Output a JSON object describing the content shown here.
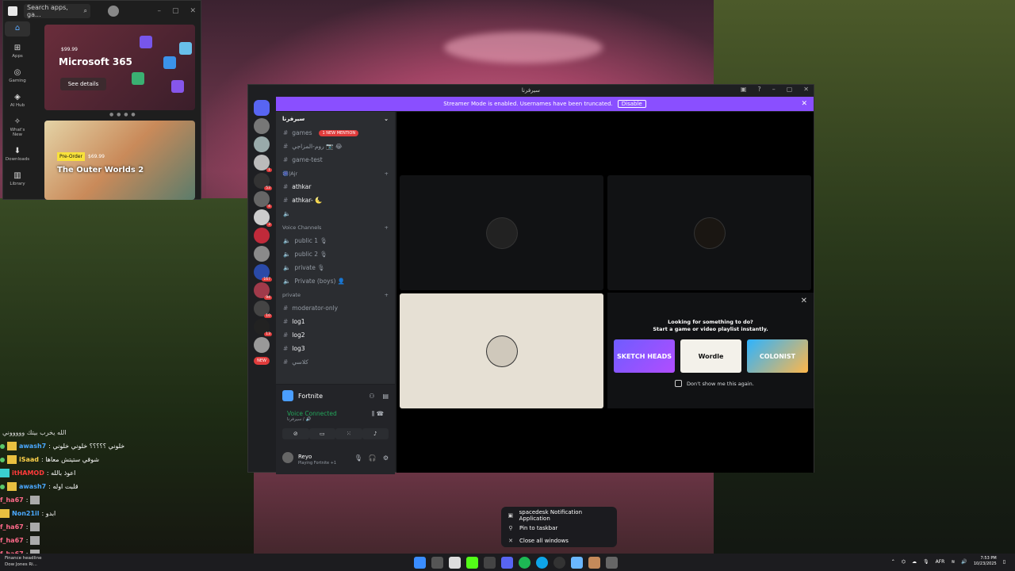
{
  "colors": {
    "discord_banner": "#8a4fff",
    "voice_green": "#23a55a",
    "mention_red": "#e03c3c",
    "xbox_accent": "#5aa9ff"
  },
  "xbox": {
    "search_placeholder": "Search apps, ga...",
    "rail": [
      {
        "label": "",
        "icon": "home-icon"
      },
      {
        "label": "Apps",
        "icon": "apps-icon"
      },
      {
        "label": "Gaming",
        "icon": "controller-icon"
      },
      {
        "label": "AI Hub",
        "icon": "ai-hub-icon"
      },
      {
        "label": "What's New",
        "icon": "whats-new-icon"
      },
      {
        "label": "Downloads",
        "icon": "downloads-icon"
      },
      {
        "label": "Library",
        "icon": "library-icon"
      }
    ],
    "featured1": {
      "price": "$99.99",
      "name": "Microsoft 365",
      "button": "See details"
    },
    "featured2": {
      "badge": "Pre-Order",
      "price": "$69.99",
      "name": "The Outer Worlds 2"
    }
  },
  "discord": {
    "window_title": "سيرفرنا",
    "banner_text": "Streamer Mode is enabled. Usernames have been truncated.",
    "banner_button": "Disable",
    "guild_name": "سيرفرنا",
    "mention_pill": "1 NEW MENTION",
    "server_new_pill": "NEW",
    "channels": [
      {
        "type": "text",
        "name": "games",
        "bold": false
      },
      {
        "type": "text",
        "name": "روم-المزاجي 📷 😂",
        "bold": false
      },
      {
        "type": "text",
        "name": "game-test",
        "bold": false
      },
      {
        "type": "category",
        "name": "🎆|Ajr"
      },
      {
        "type": "text",
        "name": "athkar",
        "bold": true
      },
      {
        "type": "text",
        "name": "athkar- 🌜",
        "bold": true
      },
      {
        "type": "voice",
        "name": "",
        "bold": false
      },
      {
        "type": "category",
        "name": "Voice Channels"
      },
      {
        "type": "voice",
        "name": "public 1 🎙",
        "bold": false
      },
      {
        "type": "voice",
        "name": "public 2 🎙",
        "bold": false
      },
      {
        "type": "voice",
        "name": "private 🎙",
        "bold": false
      },
      {
        "type": "voice",
        "name": "Private (boys) 👤",
        "bold": false
      },
      {
        "type": "category",
        "name": "private"
      },
      {
        "type": "text",
        "name": "moderator-only",
        "bold": false
      },
      {
        "type": "text",
        "name": "log1",
        "bold": true
      },
      {
        "type": "text",
        "name": "log2",
        "bold": true
      },
      {
        "type": "text",
        "name": "log3",
        "bold": true
      },
      {
        "type": "text",
        "name": "كلاسي",
        "bold": false
      }
    ],
    "activity": {
      "name": "Fortnite"
    },
    "voice": {
      "status": "Voice Connected",
      "channel": "سيرفرنا / 🔊"
    },
    "user": {
      "name": "Reyo",
      "status": "Playing Fortnite +1"
    },
    "suggest": {
      "line1": "Looking for something to do?",
      "line2": "Start a game or video playlist instantly.",
      "games": [
        "SKETCH HEADS",
        "Wordle",
        "COLONIST"
      ],
      "checkbox": "Don't show me this again."
    }
  },
  "chat": [
    {
      "name": "",
      "msg": "الله يخرب بيتك وووووني",
      "color": "#ff5a5a"
    },
    {
      "name": "awash7",
      "msg": ": خلوني ؟؟؟؟؟ خلوني خلوني",
      "color": "#4aa8ff"
    },
    {
      "name": "iSaad",
      "msg": ": شوقي ستيتش معاها",
      "color": "#ffd24a"
    },
    {
      "name": "itHAMOD",
      "msg": ": اعوذ بالله",
      "color": "#ff3a3a"
    },
    {
      "name": "awash7",
      "msg": ": قلبت اوله",
      "color": "#4aa8ff"
    },
    {
      "name": "f_ha67",
      "msg": ":",
      "color": "#ff6a8a"
    },
    {
      "name": "Non21il",
      "msg": ": ابدو",
      "color": "#4aa8ff"
    },
    {
      "name": "f_ha67",
      "msg": ":",
      "color": "#ff6a8a"
    },
    {
      "name": "f_ha67",
      "msg": ":",
      "color": "#ff6a8a"
    },
    {
      "name": "f_ha67",
      "msg": ":",
      "color": "#ff6a8a"
    }
  ],
  "weather": {
    "line1": "Finance headline",
    "line2": "Dow Jones Ri..."
  },
  "context_menu": {
    "items": [
      {
        "label": "spacedesk Notification Application",
        "icon": "app-icon"
      },
      {
        "label": "Pin to taskbar",
        "icon": "pin-icon"
      },
      {
        "label": "Close all windows",
        "icon": "close-icon"
      }
    ]
  },
  "tray": {
    "lang": "AFR",
    "time": "7:53 PM",
    "date": "10/23/2025"
  }
}
